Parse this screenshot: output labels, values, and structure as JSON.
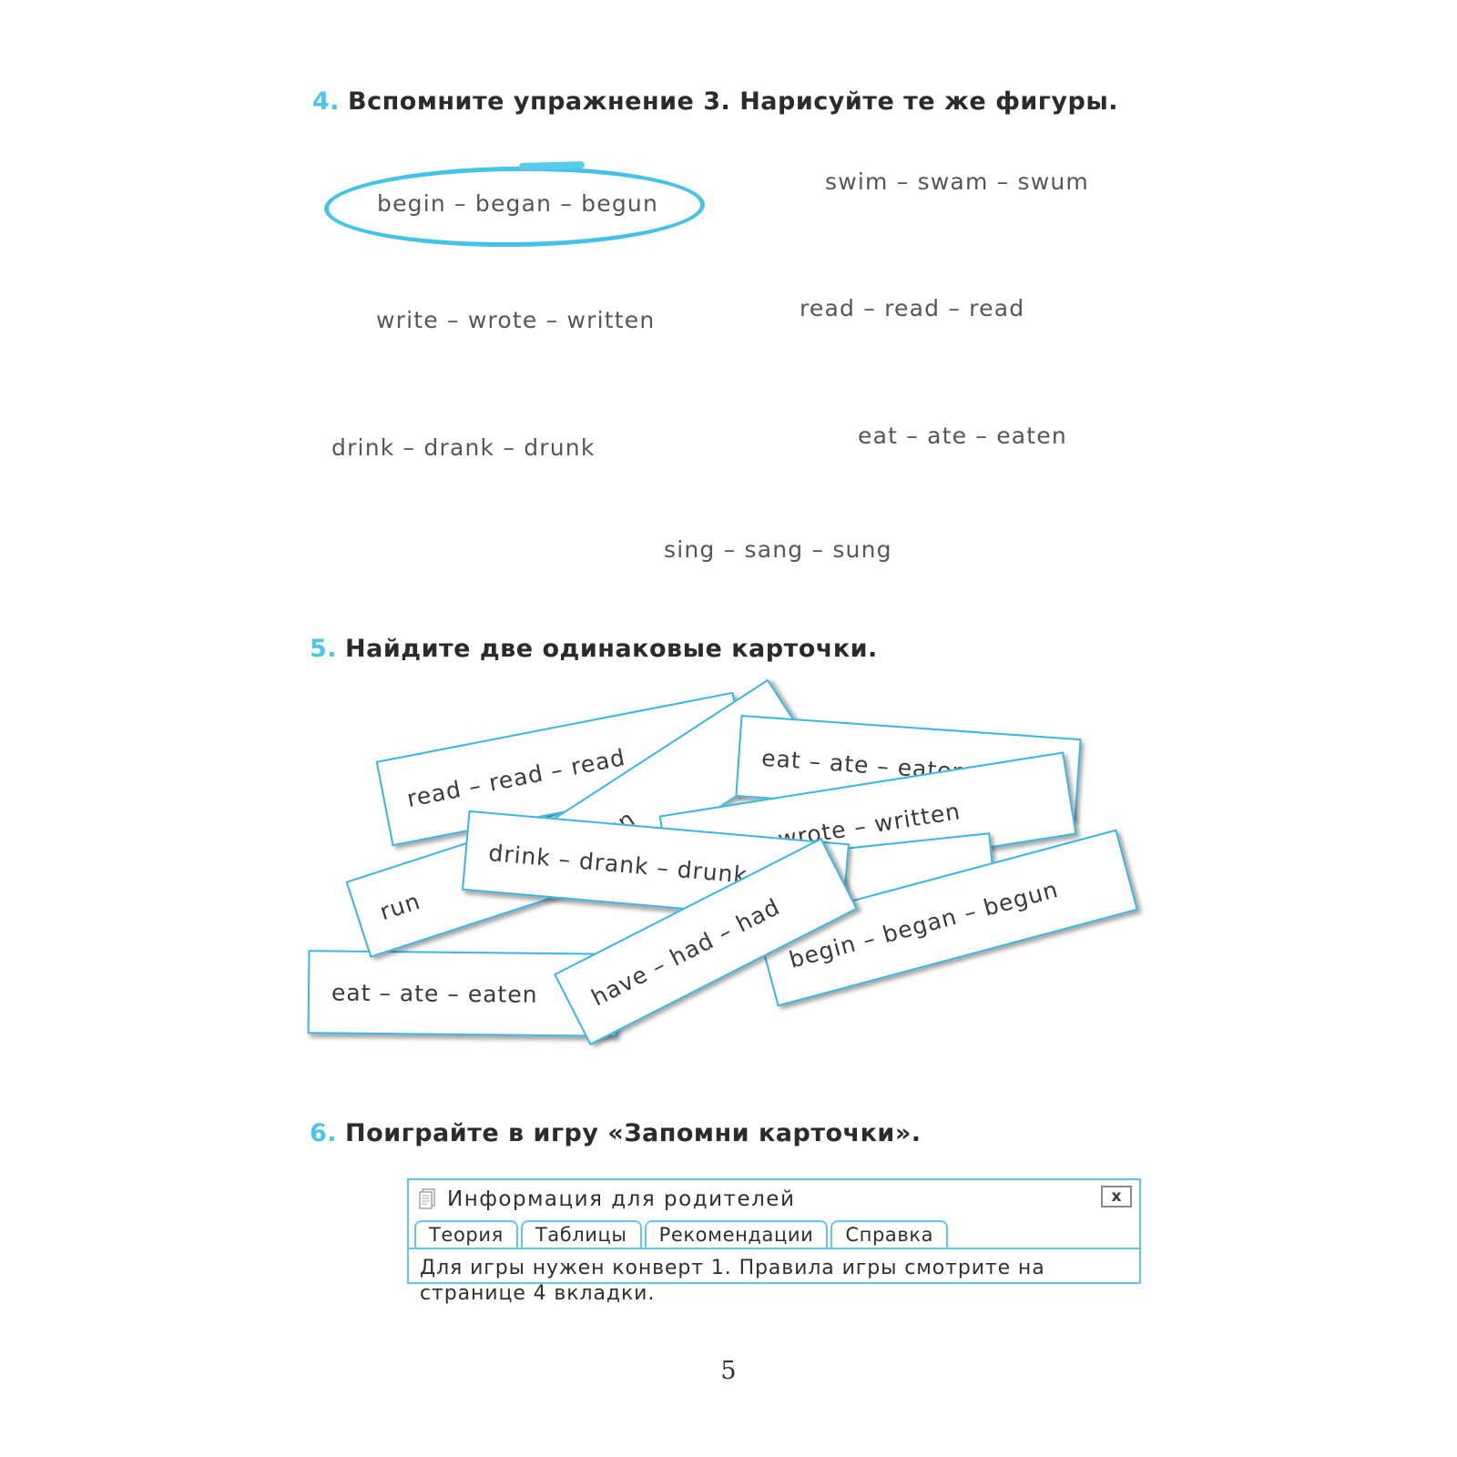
{
  "page": {
    "number": "5"
  },
  "exercise4": {
    "number": "4.",
    "title": "Вспомните упражнение 3. Нарисуйте те же фигуры.",
    "verbs": [
      {
        "text": "begin – began – begun",
        "circled": true
      },
      {
        "text": "swim – swam – swum",
        "circled": false
      },
      {
        "text": "write – wrote – written",
        "circled": false
      },
      {
        "text": "read – read – read",
        "circled": false
      },
      {
        "text": "drink – drank – drunk",
        "circled": false
      },
      {
        "text": "eat – ate – eaten",
        "circled": false
      },
      {
        "text": "sing – sang – sung",
        "circled": false
      }
    ],
    "accent_color": "#4cc6e8",
    "circle_color": "#45c3e7"
  },
  "exercise5": {
    "number": "5.",
    "title": "Найдите две одинаковые карточки.",
    "cards": [
      {
        "text": "read – read – read"
      },
      {
        "text": "eat – ate – eaten"
      },
      {
        "text": "– run"
      },
      {
        "text": "write – wrote – written"
      },
      {
        "text": "run"
      },
      {
        "text": "drink – drank – drunk"
      },
      {
        "text": "have – had – had"
      },
      {
        "text": "eat – ate – eaten"
      },
      {
        "text": "begin – began – begun"
      }
    ],
    "card_border_color": "#3ab6e4"
  },
  "exercise6": {
    "number": "6.",
    "title": "Поиграйте в игру «Запомни карточки».",
    "dialog": {
      "icon": "document-icon",
      "title": "Информация для родителей",
      "close_label": "x",
      "tabs": [
        {
          "label": "Теория",
          "active": true
        },
        {
          "label": "Таблицы",
          "active": false
        },
        {
          "label": "Рекомендации",
          "active": false
        },
        {
          "label": "Справка",
          "active": false
        }
      ],
      "body": "Для игры нужен конверт 1. Правила игры смотрите на странице 4 вкладки.",
      "border_color": "#62c8ea"
    }
  }
}
